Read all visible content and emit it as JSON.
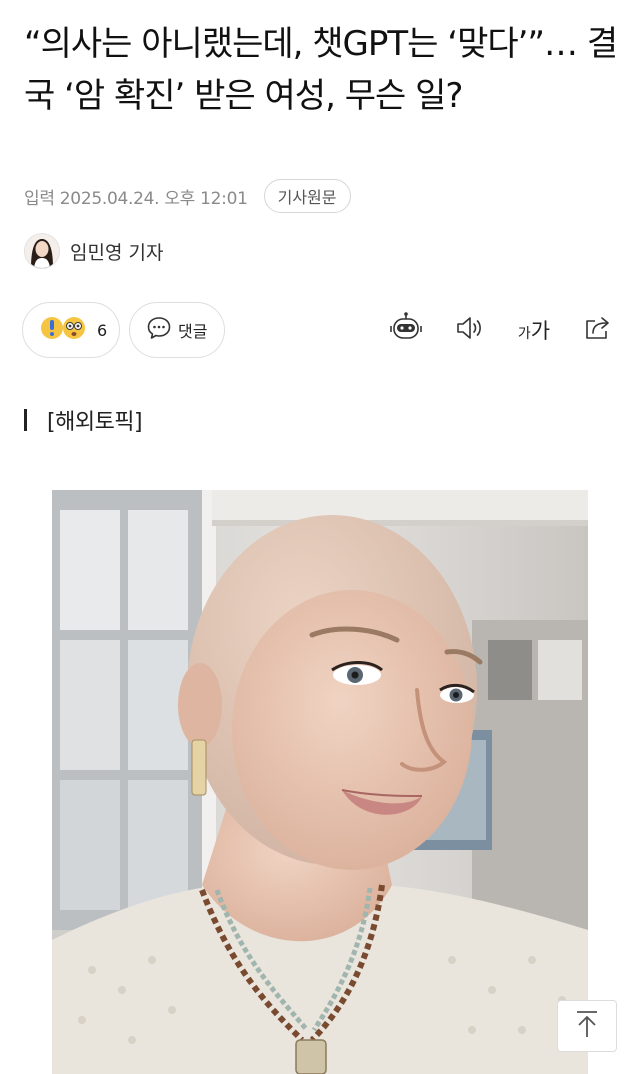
{
  "article": {
    "headline": "“의사는 아니랬는데, 챗GPT는 ‘맞다’”… 결국 ‘암 확진’ 받은 여성, 무슨 일?",
    "published": "입력 2025.04.24. 오후 12:01",
    "source_button": "기사원문",
    "reporter": "임민영 기자",
    "section": "[해외토픽]"
  },
  "actions": {
    "reaction_count": "6",
    "comment_label": "댓글",
    "font_size_small": "가",
    "font_size_big": "가"
  },
  "icons": {
    "reaction": "reaction-emoji-icon",
    "comment": "speech-bubble-icon",
    "summary": "robot-icon",
    "tts": "speaker-icon",
    "font": "font-size-icon",
    "share": "share-icon",
    "top": "arrow-up-icon"
  },
  "colors": {
    "text": "#111111",
    "meta": "#8a8a8a",
    "border": "#dedede",
    "emoji": "#f5c542"
  }
}
